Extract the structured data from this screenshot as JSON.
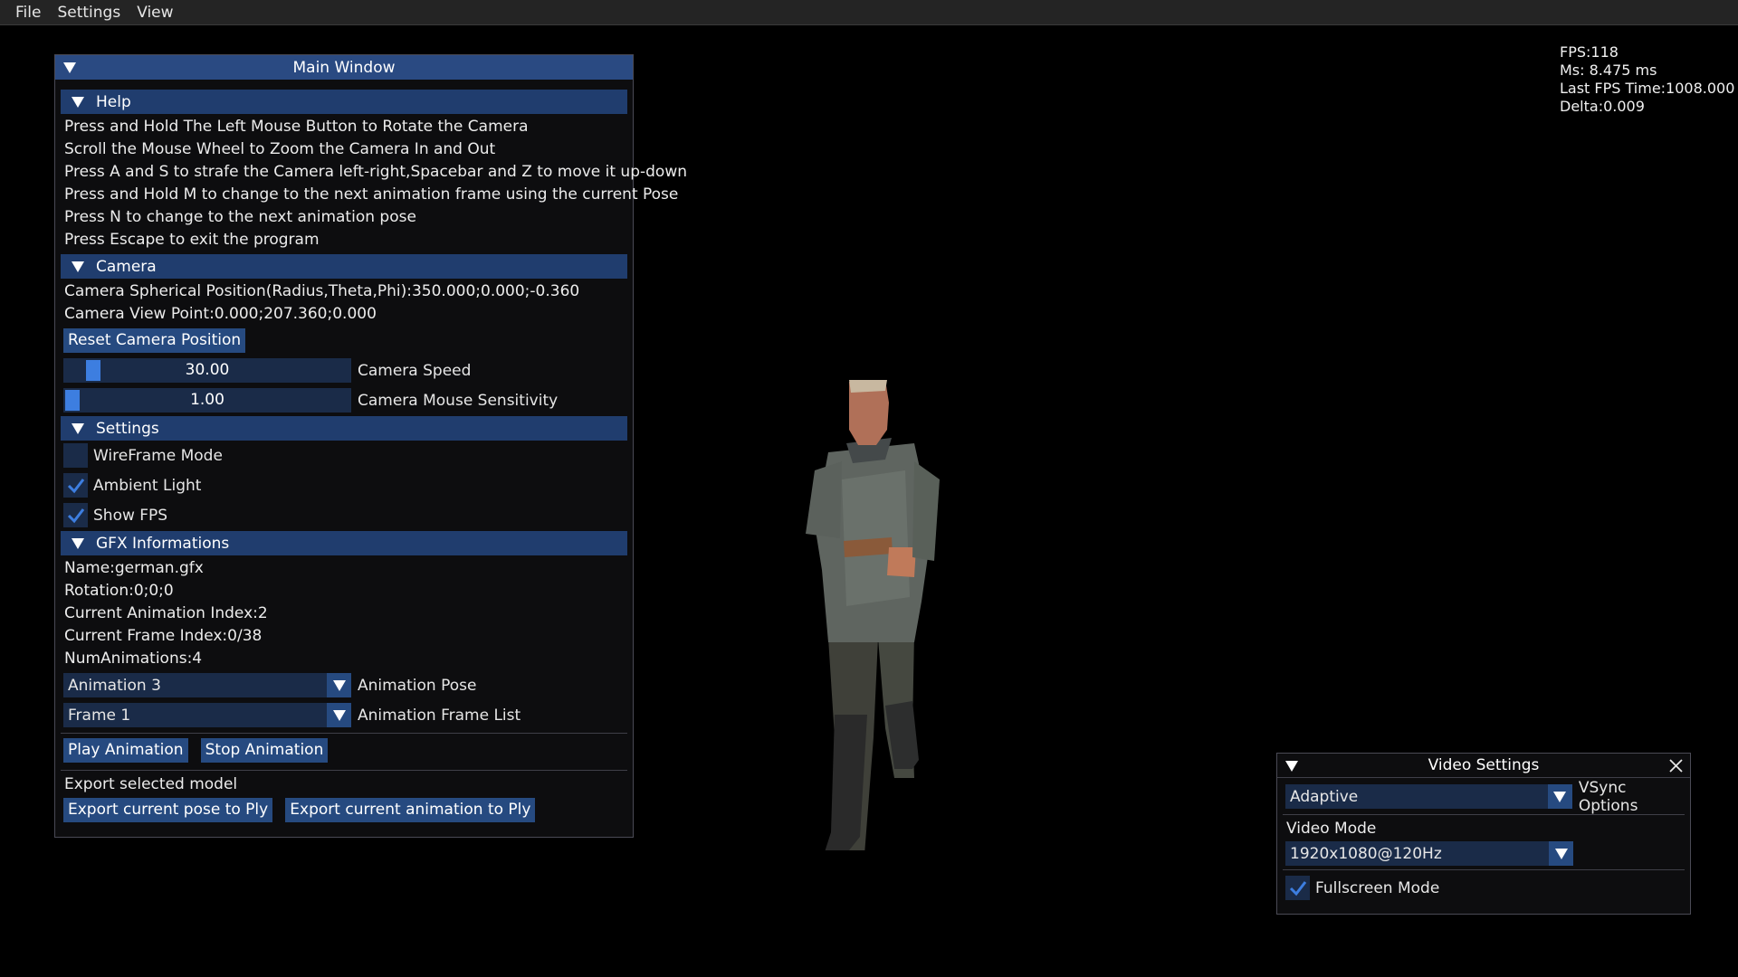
{
  "menubar": {
    "items": [
      "File",
      "Settings",
      "View"
    ]
  },
  "stats": {
    "fps": "FPS:118",
    "ms": "Ms: 8.475 ms",
    "last_fps_time": "Last FPS Time:1008.000",
    "delta": "Delta:0.009"
  },
  "main_window": {
    "title": "Main Window",
    "help": {
      "header": "Help",
      "lines": [
        "Press and Hold The Left Mouse Button to Rotate the Camera",
        "Scroll the Mouse Wheel to Zoom the Camera In and Out",
        "Press A and S to strafe the Camera left-right,Spacebar and Z to move it up-down",
        "Press and Hold M to change to the next animation frame using the current Pose",
        "Press N to change to the next animation pose",
        "Press Escape to exit the program"
      ]
    },
    "camera": {
      "header": "Camera",
      "spherical": "Camera Spherical Position(Radius,Theta,Phi):350.000;0.000;-0.360",
      "view_point": "Camera View Point:0.000;207.360;0.000",
      "reset_button": "Reset Camera Position",
      "speed_value": "30.00",
      "speed_label": "Camera Speed",
      "sensitivity_value": "1.00",
      "sensitivity_label": "Camera Mouse Sensitivity"
    },
    "settings": {
      "header": "Settings",
      "wireframe": {
        "label": "WireFrame Mode",
        "checked": false
      },
      "ambient": {
        "label": "Ambient Light",
        "checked": true
      },
      "show_fps": {
        "label": "Show FPS",
        "checked": true
      }
    },
    "gfx": {
      "header": "GFX Informations",
      "name": "Name:german.gfx",
      "rotation": "Rotation:0;0;0",
      "anim_index": "Current Animation Index:2",
      "frame_index": "Current Frame Index:0/38",
      "num_anims": "NumAnimations:4",
      "pose_value": "Animation 3",
      "pose_label": "Animation Pose",
      "frame_value": "Frame 1",
      "frame_label": "Animation Frame List",
      "play_button": "Play Animation",
      "stop_button": "Stop Animation",
      "export_label": "Export selected model",
      "export_pose_button": "Export current pose to Ply",
      "export_anim_button": "Export current animation to Ply"
    }
  },
  "video_window": {
    "title": "Video Settings",
    "vsync_value": "Adaptive",
    "vsync_label": "VSync Options",
    "video_mode_label": "Video Mode",
    "video_mode_value": "1920x1080@120Hz",
    "fullscreen": {
      "label": "Fullscreen Mode",
      "checked": true
    }
  },
  "colors": {
    "title_bar": "#2a4a82",
    "header": "#203d6e",
    "button": "#264a80",
    "frame_bg": "#1a2b48",
    "slider_grab": "#3d7ee0",
    "check_mark": "#3d7ee0"
  }
}
